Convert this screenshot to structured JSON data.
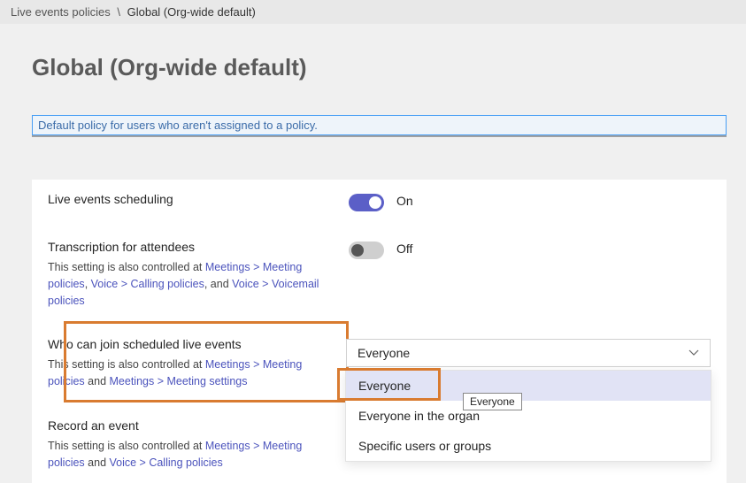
{
  "breadcrumb": {
    "parent": "Live events policies",
    "separator": "\\",
    "current": "Global (Org-wide default)"
  },
  "page": {
    "title": "Global (Org-wide default)",
    "description": "Default policy for users who aren't assigned to a policy."
  },
  "settings": {
    "scheduling": {
      "label": "Live events scheduling",
      "state_text": "On"
    },
    "transcription": {
      "label": "Transcription for attendees",
      "desc_parts": {
        "prefix": "This setting is also controlled at ",
        "link1": "Meetings > Meeting policies",
        "sep1": ", ",
        "link2": "Voice > Calling policies",
        "sep2": ", and ",
        "link3": "Voice > Voicemail policies"
      },
      "state_text": "Off"
    },
    "who_join": {
      "label": "Who can join scheduled live events",
      "desc_parts": {
        "prefix": "This setting is also controlled at ",
        "link1": "Meetings > Meeting policies",
        "sep1": " and ",
        "link2": "Meetings > Meeting settings"
      },
      "dropdown": {
        "selected": "Everyone",
        "options": {
          "opt1": "Everyone",
          "opt2": "Everyone in the organ",
          "opt3": "Specific users or groups"
        },
        "tooltip": "Everyone"
      }
    },
    "record": {
      "label": "Record an event",
      "desc_parts": {
        "prefix": "This setting is also controlled at ",
        "link1": "Meetings > Meeting policies",
        "sep1": " and ",
        "link2": "Voice > Calling policies"
      }
    }
  }
}
